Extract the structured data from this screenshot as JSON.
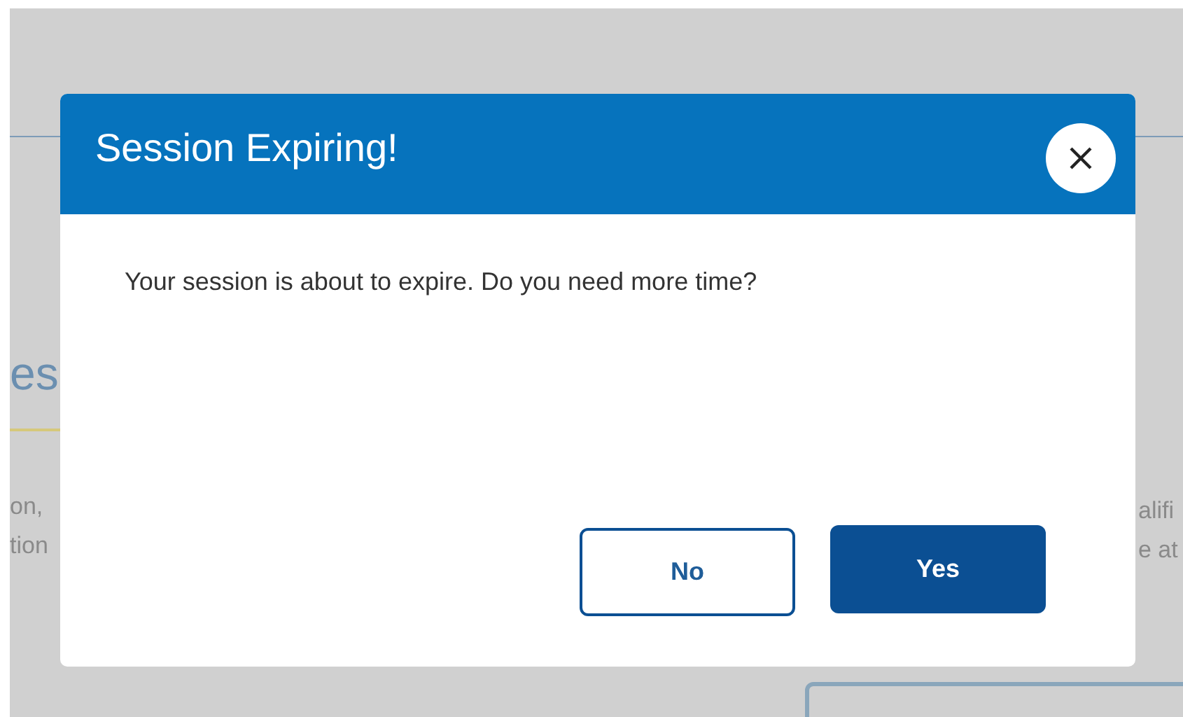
{
  "background": {
    "heading_fragment": "es",
    "left_lines": [
      "on,",
      "tion"
    ],
    "right_lines": [
      "alifi",
      "e at"
    ]
  },
  "dialog": {
    "title": "Session Expiring!",
    "message": "Your session is about to expire. Do you need more time?",
    "buttons": [
      {
        "label": "No",
        "kind": "secondary"
      },
      {
        "label": "Yes",
        "kind": "primary"
      }
    ]
  }
}
